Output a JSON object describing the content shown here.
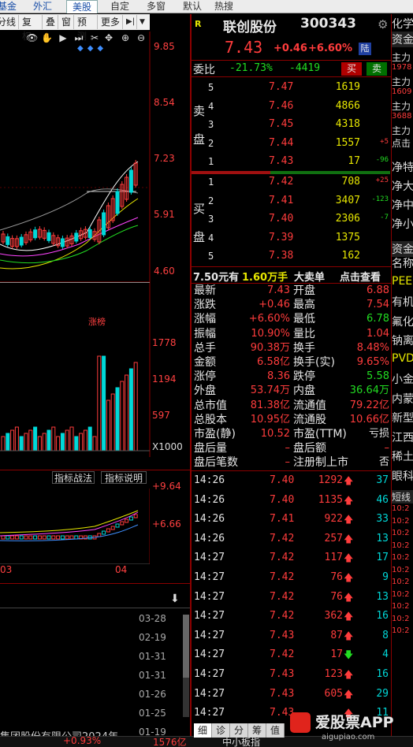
{
  "top_tabs": [
    "基金",
    "外汇",
    "美股",
    "自定",
    "多窗",
    "默认",
    "热搜"
  ],
  "toolbar": {
    "items": [
      "分线",
      "复权",
      "叠",
      "窗",
      "预测",
      "更多"
    ]
  },
  "kline": {
    "y_labels": [
      "9.85",
      "8.54",
      "7.23",
      "5.91",
      "4.60"
    ],
    "volume_y_labels": [
      "1778",
      "1194",
      "597",
      "X1000"
    ],
    "zhangbang_label": "涨榜",
    "indicator_buttons": [
      "指标战法",
      "指标说明"
    ],
    "indicator_y_labels": [
      "+9.64",
      "+6.66"
    ],
    "x_labels": [
      "03",
      "04"
    ]
  },
  "news_dates": [
    "03-28",
    "02-19",
    "01-31",
    "01-31",
    "01-26",
    "01-25",
    "01-19"
  ],
  "news_bottom_text": "集团股份有限公司2024年",
  "status_bar": {
    "change": "+0.93%",
    "amount": "1576亿",
    "board": "中小板指"
  },
  "stock": {
    "r_badge": "R",
    "name": "联创股份",
    "code": "300343",
    "price": "7.43",
    "change": "+0.46",
    "change_pct": "+6.60%",
    "market_badge": "陆"
  },
  "weibi": {
    "label": "委比",
    "pct": "-21.73%",
    "diff": "-4419",
    "buy": "买",
    "sell": "卖"
  },
  "sell_label": [
    "卖",
    "盘"
  ],
  "buy_label": [
    "买",
    "盘"
  ],
  "sells": [
    {
      "lvl": "5",
      "price": "7.47",
      "vol": "1619",
      "chg": ""
    },
    {
      "lvl": "4",
      "price": "7.46",
      "vol": "4866",
      "chg": ""
    },
    {
      "lvl": "3",
      "price": "7.45",
      "vol": "4318",
      "chg": ""
    },
    {
      "lvl": "2",
      "price": "7.44",
      "vol": "1557",
      "chg": "+5"
    },
    {
      "lvl": "1",
      "price": "7.43",
      "vol": "17",
      "chg": "-96"
    }
  ],
  "buys": [
    {
      "lvl": "1",
      "price": "7.42",
      "vol": "708",
      "chg": "+25"
    },
    {
      "lvl": "2",
      "price": "7.41",
      "vol": "3407",
      "chg": "-123"
    },
    {
      "lvl": "3",
      "price": "7.40",
      "vol": "2306",
      "chg": "-7"
    },
    {
      "lvl": "4",
      "price": "7.39",
      "vol": "1375",
      "chg": ""
    },
    {
      "lvl": "5",
      "price": "7.38",
      "vol": "162",
      "chg": ""
    }
  ],
  "big_order": {
    "price": "7.50元有",
    "amount": "1.60万手",
    "label": "大卖单",
    "link": "点击查看"
  },
  "stats": [
    [
      "最新",
      "7.43",
      "开盘",
      "6.88"
    ],
    [
      "涨跌",
      "+0.46",
      "最高",
      "7.54"
    ],
    [
      "涨幅",
      "+6.60%",
      "最低",
      "6.78"
    ],
    [
      "振幅",
      "10.90%",
      "量比",
      "1.04"
    ],
    [
      "总手",
      "90.38万",
      "换手",
      "8.48%"
    ],
    [
      "金额",
      "6.58亿",
      "换手(实)",
      "9.65%"
    ],
    [
      "涨停",
      "8.36",
      "跌停",
      "5.58"
    ],
    [
      "外盘",
      "53.74万",
      "内盘",
      "36.64万"
    ],
    [
      "总市值",
      "81.38亿",
      "流通值",
      "79.22亿"
    ],
    [
      "总股本",
      "10.95亿",
      "流通股",
      "10.66亿"
    ],
    [
      "市盈(静)",
      "10.52",
      "市盈(TTM)",
      "亏损"
    ],
    [
      "盘后量",
      "–",
      "盘后额",
      "–"
    ],
    [
      "盘后笔数",
      "–",
      "注册制上市",
      "否"
    ]
  ],
  "ticks": [
    {
      "t": "14:26",
      "p": "7.40",
      "v": "1292",
      "d": "up",
      "n": "37"
    },
    {
      "t": "14:26",
      "p": "7.40",
      "v": "1135",
      "d": "up",
      "n": "46"
    },
    {
      "t": "14:26",
      "p": "7.41",
      "v": "922",
      "d": "up",
      "n": "33"
    },
    {
      "t": "14:26",
      "p": "7.42",
      "v": "257",
      "d": "up",
      "n": "13"
    },
    {
      "t": "14:27",
      "p": "7.42",
      "v": "117",
      "d": "up",
      "n": "17"
    },
    {
      "t": "14:27",
      "p": "7.42",
      "v": "76",
      "d": "up",
      "n": "9"
    },
    {
      "t": "14:27",
      "p": "7.42",
      "v": "76",
      "d": "up",
      "n": "13"
    },
    {
      "t": "14:27",
      "p": "7.42",
      "v": "362",
      "d": "up",
      "n": "16"
    },
    {
      "t": "14:27",
      "p": "7.43",
      "v": "87",
      "d": "up",
      "n": "8"
    },
    {
      "t": "14:27",
      "p": "7.42",
      "v": "17",
      "d": "down",
      "n": "4"
    },
    {
      "t": "14:27",
      "p": "7.43",
      "v": "123",
      "d": "up",
      "n": "16"
    },
    {
      "t": "14:27",
      "p": "7.43",
      "v": "605",
      "d": "up",
      "n": "29"
    },
    {
      "t": "14:27",
      "p": "7.43",
      "v": "",
      "d": "up",
      "n": "11"
    }
  ],
  "bottom_tabs": [
    "细",
    "诊",
    "分",
    "筹",
    "值"
  ],
  "watermark": {
    "brand": "爱股票APP",
    "url": "aigupiao.com"
  },
  "sidebar": {
    "title": "化学",
    "tab": "资金",
    "items": [
      "主力",
      "1978",
      "主力",
      "1609",
      "主力",
      "3688",
      "主力",
      "点击"
    ],
    "flows": [
      "净特",
      "净大",
      "净中",
      "净小"
    ],
    "concept_tab": "资金",
    "concepts": [
      "名称",
      "PEE",
      "有机",
      "氟化",
      "钠离",
      "PVD",
      "小金",
      "内蒙",
      "新型",
      "江西",
      "稀土",
      "眼科"
    ],
    "short_label": "短线",
    "short_items": [
      "10:2",
      "10:2",
      "10:2",
      "10:2",
      "10:2",
      "10:2",
      "10:2",
      "10:2",
      "10:2",
      "10:2",
      "10:2"
    ]
  },
  "colors": {
    "up": "#ff3c3c",
    "down": "#22dd22",
    "frame": "#8b0000",
    "volume_cyan": "#00d8d8",
    "volume_red": "#ff3c3c"
  }
}
